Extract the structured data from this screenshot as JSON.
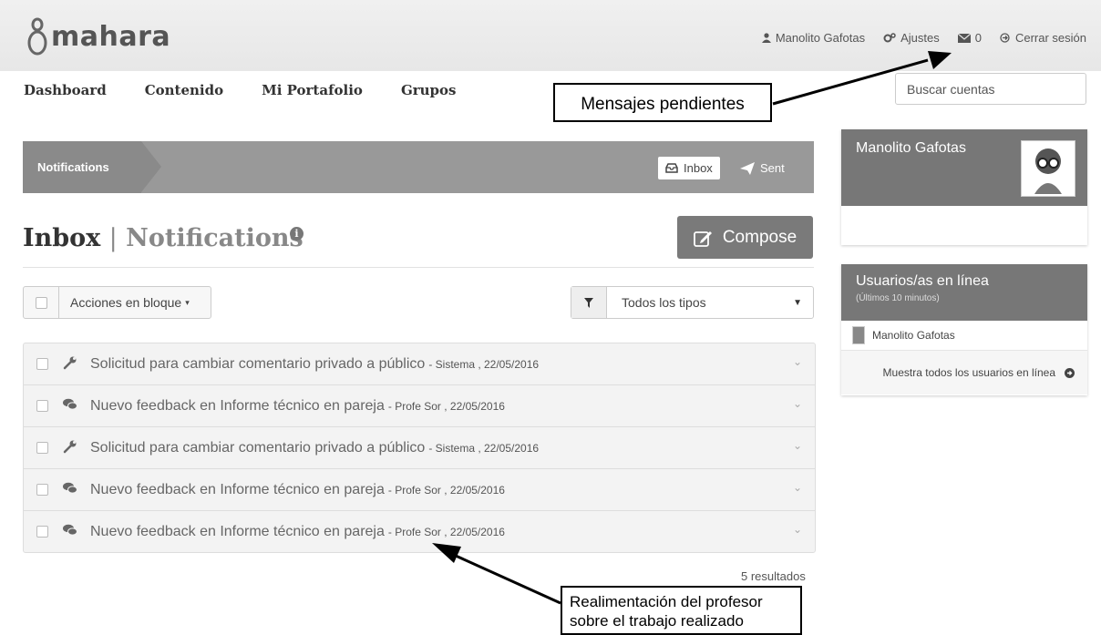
{
  "header": {
    "logo_text": "mahara",
    "user_link": "Manolito Gafotas",
    "settings_link": "Ajustes",
    "inbox_count": "0",
    "logout_link": "Cerrar sesión"
  },
  "nav": {
    "items": [
      "Dashboard",
      "Contenido",
      "Mi Portafolio",
      "Grupos"
    ]
  },
  "search": {
    "placeholder": "Buscar cuentas"
  },
  "subnav": {
    "crumb": "Notifications",
    "inbox": "Inbox",
    "sent": "Sent"
  },
  "page": {
    "title_main": "Inbox",
    "title_sep": "|",
    "title_secondary": "Notifications",
    "compose": "Compose",
    "bulk_actions": "Acciones en bloque",
    "filter": "Todos los tipos",
    "results": "5 resultados"
  },
  "messages": [
    {
      "icon": "wrench-icon",
      "subject": "Solicitud para cambiar comentario privado a público",
      "meta": "- Sistema , 22/05/2016"
    },
    {
      "icon": "comments-icon",
      "subject": "Nuevo feedback en Informe técnico en pareja",
      "meta": "- Profe Sor , 22/05/2016"
    },
    {
      "icon": "wrench-icon",
      "subject": "Solicitud para cambiar comentario privado a público",
      "meta": "- Sistema , 22/05/2016"
    },
    {
      "icon": "comments-icon",
      "subject": "Nuevo feedback en Informe técnico en pareja",
      "meta": "- Profe Sor , 22/05/2016"
    },
    {
      "icon": "comments-icon",
      "subject": "Nuevo feedback en Informe técnico en pareja",
      "meta": "- Profe Sor , 22/05/2016"
    }
  ],
  "sidebar": {
    "profile_name": "Manolito Gafotas",
    "online_title": "Usuarios/as en línea",
    "online_subtitle": "(Últimos 10 minutos)",
    "online_user": "Manolito Gafotas",
    "show_all": "Muestra todos los usuarios en línea"
  },
  "annotations": {
    "pending": "Mensajes pendientes",
    "feedback_line1": "Realimentación del profesor",
    "feedback_line2": "sobre el trabajo realizado"
  }
}
